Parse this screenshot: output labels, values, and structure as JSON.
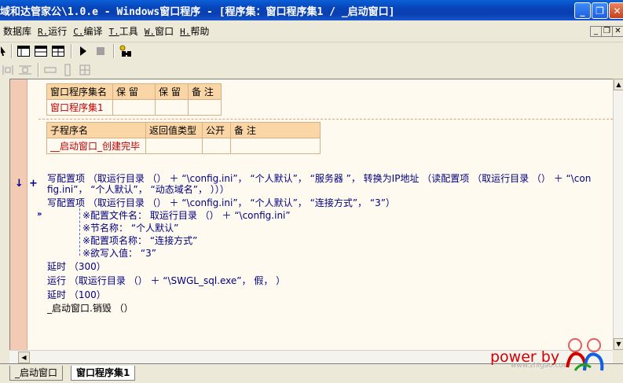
{
  "window": {
    "title": "域和达管家公\\1.0.e - Windows窗口程序 - [程序集：窗口程序集1 / _启动窗口]",
    "minimize": "_",
    "restore": "❐",
    "close": "✕"
  },
  "menu": [
    {
      "key": "",
      "label": "数据库"
    },
    {
      "key": "R.",
      "label": "运行"
    },
    {
      "key": "C.",
      "label": "编译"
    },
    {
      "key": "T.",
      "label": "工具"
    },
    {
      "key": "W.",
      "label": "窗口"
    },
    {
      "key": "H.",
      "label": "帮助"
    }
  ],
  "mdi": {
    "min": "_",
    "restore": "❐",
    "close": "✕"
  },
  "assembly_table": {
    "headers": [
      "窗口程序集名",
      "保 留",
      "保 留",
      "备 注"
    ],
    "row": [
      "窗口程序集1",
      "",
      "",
      ""
    ]
  },
  "sub_table": {
    "headers": [
      "子程序名",
      "返回值类型",
      "公开",
      "备 注"
    ],
    "row": [
      "__启动窗口_创建完毕",
      "",
      "",
      ""
    ]
  },
  "code": {
    "line1a": "写配置项 （取运行目录 （） ＋ “\\config.ini”， “个人默认”， “服务器 ”， 转换为IP地址 （读配置项 （取运行目录 （） ＋ “\\con",
    "line1b": "fig.ini”， “个人默认”， “动态域名”， ）））",
    "line2": "写配置项 （取运行目录 （） ＋ “\\config.ini”， “个人默认”， “连接方式”， “3”）",
    "param1": "※配置文件名： 取运行目录 （） ＋ “\\config.ini”",
    "param2": "※节名称： “个人默认”",
    "param3": "※配置项名称： “连接方式”",
    "param4": "※欲写入值： “3”",
    "line3": "延时 （300）",
    "line4": "运行 （取运行目录 （） ＋ “\\SWGL_sql.exe”， 假， ）",
    "line5": "延时 （100）",
    "line6": "_启动窗口.销毁 （）"
  },
  "tabs": [
    "_启动窗口",
    "窗口程序集1"
  ],
  "watermark": {
    "text": "power by",
    "site": "www.zhigao.com"
  },
  "colors": {
    "title_bar": "#0a3fb0",
    "gutter": "#f3cbb5",
    "editor_bg": "#fffaf0",
    "table_head": "#fad5a5",
    "string": "#c000c0",
    "keyword": "#000080"
  }
}
